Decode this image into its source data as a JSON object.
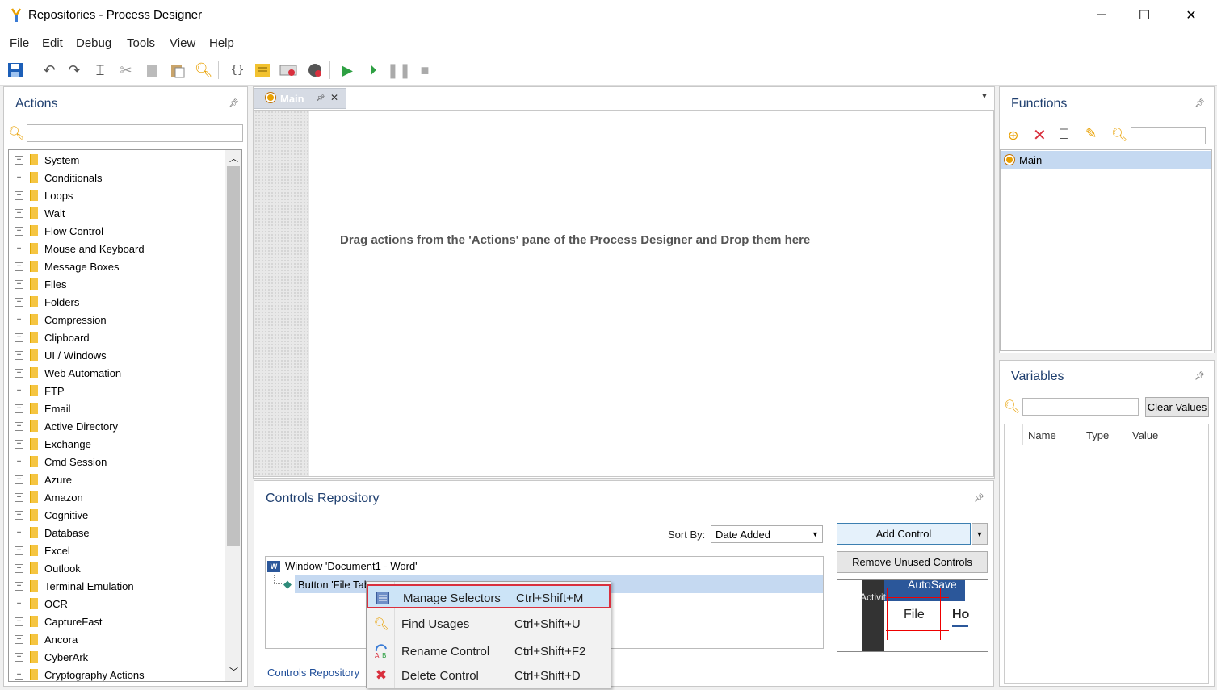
{
  "window": {
    "title": "Repositories - Process Designer",
    "minimize": "─",
    "maximize": "☐",
    "close": "✕"
  },
  "menu": [
    "File",
    "Edit",
    "Debug",
    "Tools",
    "View",
    "Help"
  ],
  "actions_panel": {
    "title": "Actions",
    "search_placeholder": "",
    "items": [
      "System",
      "Conditionals",
      "Loops",
      "Wait",
      "Flow Control",
      "Mouse and Keyboard",
      "Message Boxes",
      "Files",
      "Folders",
      "Compression",
      "Clipboard",
      "UI / Windows",
      "Web Automation",
      "FTP",
      "Email",
      "Active Directory",
      "Exchange",
      "Cmd Session",
      "Azure",
      "Amazon",
      "Cognitive",
      "Database",
      "Excel",
      "Outlook",
      "Terminal Emulation",
      "OCR",
      "CaptureFast",
      "Ancora",
      "CyberArk",
      "Cryptography Actions"
    ]
  },
  "document": {
    "tab_label": "Main",
    "drop_hint": "Drag actions from the 'Actions' pane of the Process Designer and Drop them here"
  },
  "controls_repository": {
    "title": "Controls Repository",
    "sort_label": "Sort By:",
    "sort_value": "Date Added",
    "add_control": "Add Control",
    "remove_unused": "Remove Unused Controls",
    "bottom_tab": "Controls Repository",
    "tree": {
      "window_node": "Window 'Document1 - Word'",
      "button_node": "Button 'File Tab'"
    },
    "preview": {
      "autosave": "AutoSave",
      "activity": "Activit",
      "file": "File",
      "home": "Ho"
    }
  },
  "context_menu": [
    {
      "label": "Manage Selectors",
      "shortcut": "Ctrl+Shift+M",
      "icon": "list-icon",
      "highlighted": true
    },
    {
      "label": "Find Usages",
      "shortcut": "Ctrl+Shift+U",
      "icon": "search-icon",
      "highlighted": false
    },
    {
      "label": "Rename Control",
      "shortcut": "Ctrl+Shift+F2",
      "icon": "rename-icon",
      "highlighted": false
    },
    {
      "label": "Delete Control",
      "shortcut": "Ctrl+Shift+D",
      "icon": "delete-icon",
      "highlighted": false
    }
  ],
  "functions_panel": {
    "title": "Functions",
    "items": [
      "Main"
    ]
  },
  "variables_panel": {
    "title": "Variables",
    "clear_values": "Clear Values",
    "columns": [
      "Name",
      "Type",
      "Value"
    ]
  },
  "colors": {
    "accent": "#1f3f6f",
    "selection": "#c5d9f1",
    "highlight_border": "#d9303e",
    "run_green": "#2ea043"
  }
}
